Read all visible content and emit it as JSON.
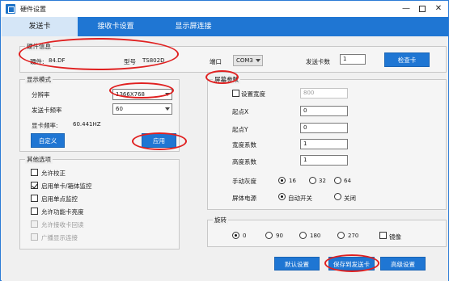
{
  "window": {
    "title": "硬件设置",
    "controls": {
      "minimize": "—",
      "close": "✕"
    }
  },
  "tabs": [
    {
      "label": "发送卡",
      "active": true
    },
    {
      "label": "接收卡设置",
      "active": false
    },
    {
      "label": "显示屏连接",
      "active": false
    }
  ],
  "hardware_info": {
    "group_title": "硬件信息",
    "hardware_label": "硬件:",
    "hardware_value": "84.DF",
    "model_label": "型号",
    "model_value": "TS802D",
    "port_label": "端口",
    "port_value": "COM3",
    "card_count_label": "发送卡数",
    "card_count_value": "1",
    "check_card_button": "检查卡"
  },
  "display_mode": {
    "group_title": "显示模式",
    "resolution_label": "分辨率",
    "resolution_value": "1366X768",
    "frequency_label": "发送卡频率",
    "frequency_value": "60",
    "refresh_label": "显卡频率:",
    "refresh_value": "60.441HZ",
    "custom_button": "自定义",
    "apply_button": "应用"
  },
  "screen_params": {
    "group_title": "屏幕参数",
    "set_width_label": "设置宽度",
    "set_width_value": "800",
    "start_x_label": "起点X",
    "start_x_value": "0",
    "start_y_label": "起点Y",
    "start_y_value": "0",
    "width_coef_label": "宽度系数",
    "width_coef_value": "1",
    "height_coef_label": "高度系数",
    "height_coef_value": "1",
    "gray_label": "手动灰度",
    "gray_options": [
      "16",
      "32",
      "64"
    ],
    "gray_selected": "16",
    "power_label": "屏体电源",
    "power_options": [
      "自动开关",
      "关闭"
    ],
    "power_selected": "自动开关"
  },
  "other_options": {
    "group_title": "其他选项",
    "items": [
      {
        "label": "允许校正",
        "checked": false,
        "disabled": false
      },
      {
        "label": "启用单卡/箱体监控",
        "checked": true,
        "disabled": false
      },
      {
        "label": "启用单点监控",
        "checked": false,
        "disabled": false
      },
      {
        "label": "允许功能卡亮度",
        "checked": false,
        "disabled": false
      },
      {
        "label": "允许接收卡回读",
        "checked": false,
        "disabled": true
      },
      {
        "label": "广播显示连接",
        "checked": false,
        "disabled": true
      }
    ]
  },
  "rotation": {
    "group_title": "旋转",
    "options": [
      "0",
      "90",
      "180",
      "270"
    ],
    "selected": "0",
    "mirror_label": "镜像"
  },
  "footer": {
    "default_button": "默认设置",
    "save_button": "保存到发送卡",
    "advanced_button": "高级设置"
  },
  "colors": {
    "accent": "#1f76d3",
    "highlight_ring": "#e02020",
    "active_tab": "#d5e6f7"
  }
}
